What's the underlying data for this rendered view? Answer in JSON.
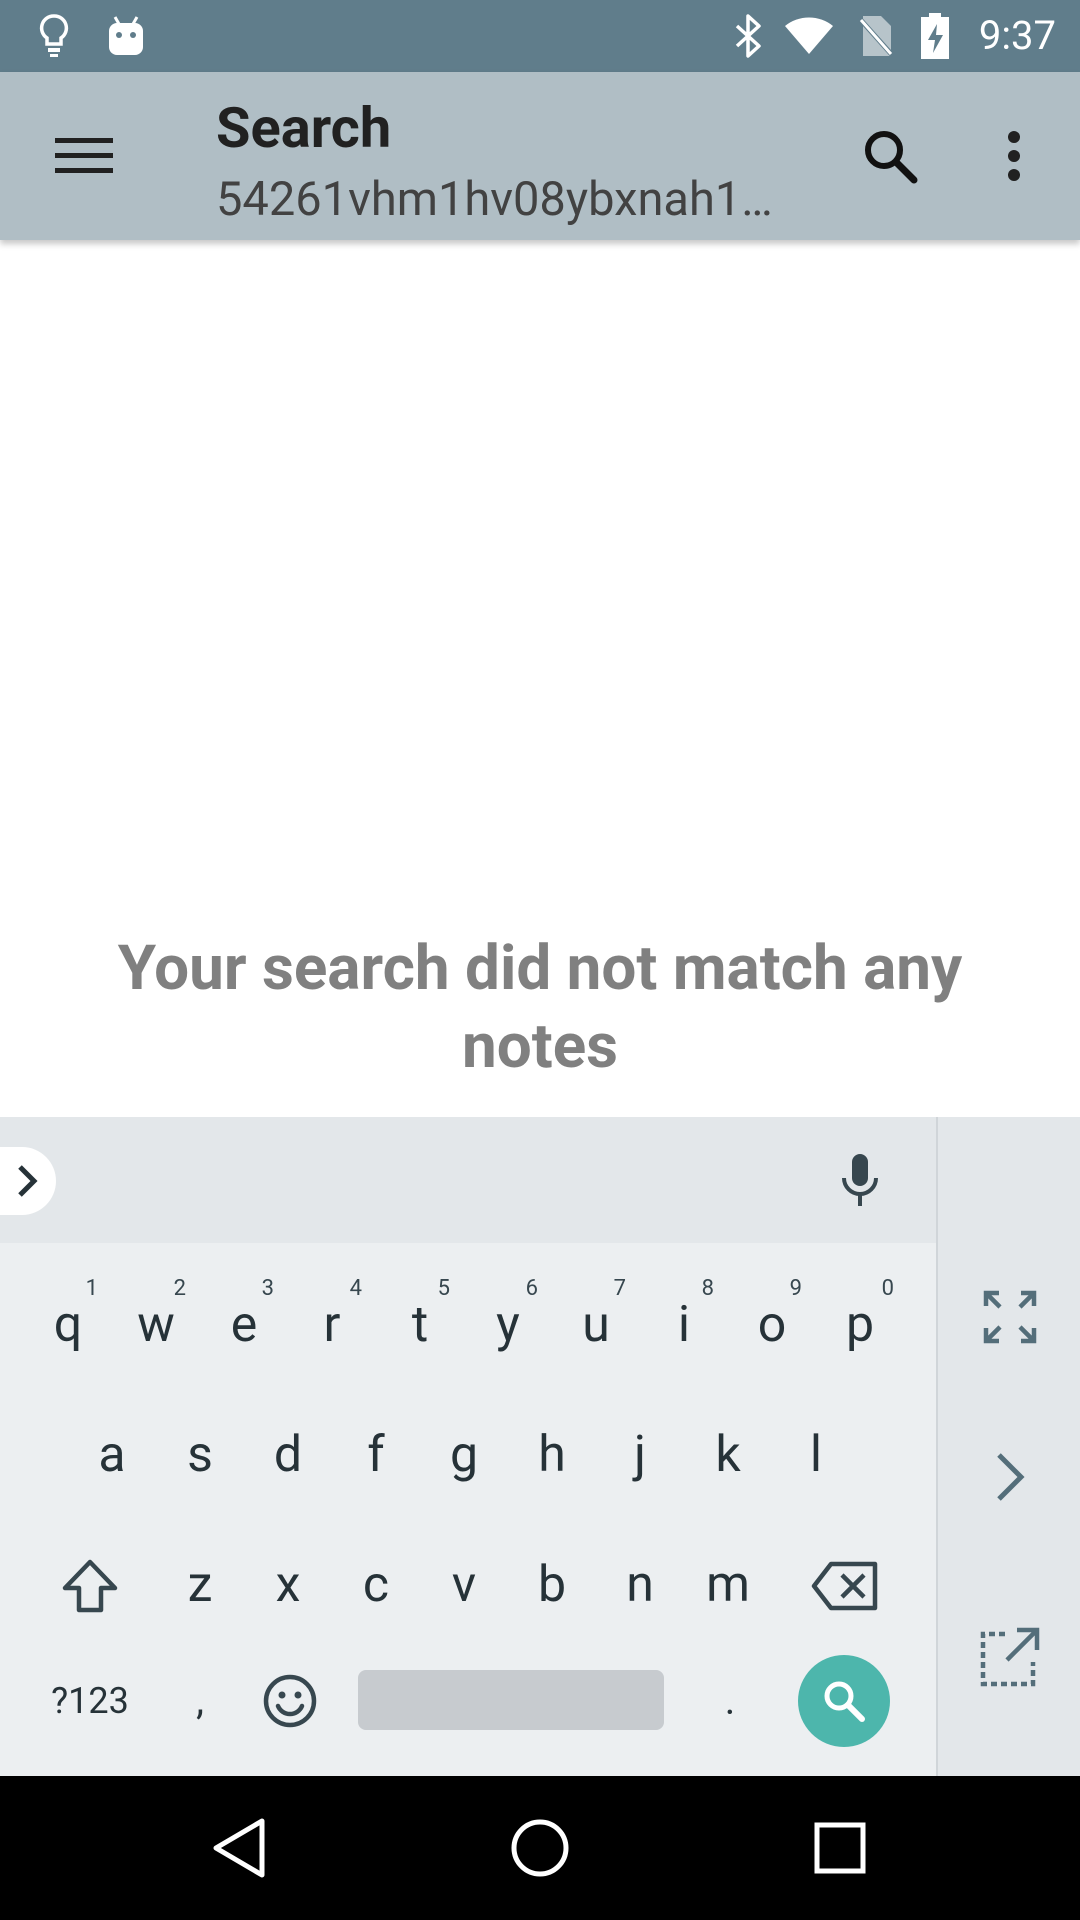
{
  "status_bar": {
    "time": "9:37",
    "icons": [
      "lightbulb-icon",
      "android-icon",
      "bluetooth-icon",
      "wifi-icon",
      "no-sim-icon",
      "battery-charging-icon"
    ]
  },
  "app_bar": {
    "title": "Search",
    "subtitle": "54261vhm1hv08ybxnah1…",
    "icons": [
      "menu-icon",
      "search-icon",
      "more-vert-icon"
    ]
  },
  "main": {
    "empty_message": "Your search did not match any notes"
  },
  "keyboard": {
    "row1": [
      {
        "label": "q",
        "hint": "1"
      },
      {
        "label": "w",
        "hint": "2"
      },
      {
        "label": "e",
        "hint": "3"
      },
      {
        "label": "r",
        "hint": "4"
      },
      {
        "label": "t",
        "hint": "5"
      },
      {
        "label": "y",
        "hint": "6"
      },
      {
        "label": "u",
        "hint": "7"
      },
      {
        "label": "i",
        "hint": "8"
      },
      {
        "label": "o",
        "hint": "9"
      },
      {
        "label": "p",
        "hint": "0"
      }
    ],
    "row2": [
      "a",
      "s",
      "d",
      "f",
      "g",
      "h",
      "j",
      "k",
      "l"
    ],
    "row3": [
      "z",
      "x",
      "c",
      "v",
      "b",
      "n",
      "m"
    ],
    "symbols_label": "?123",
    "comma_label": ",",
    "period_label": ".",
    "action": "search",
    "side_icons": [
      "fullscreen-icon",
      "chevron-right-icon",
      "open-in-new-icon"
    ]
  },
  "nav_bar": {
    "icons": [
      "back-icon",
      "home-icon",
      "recents-icon"
    ]
  }
}
